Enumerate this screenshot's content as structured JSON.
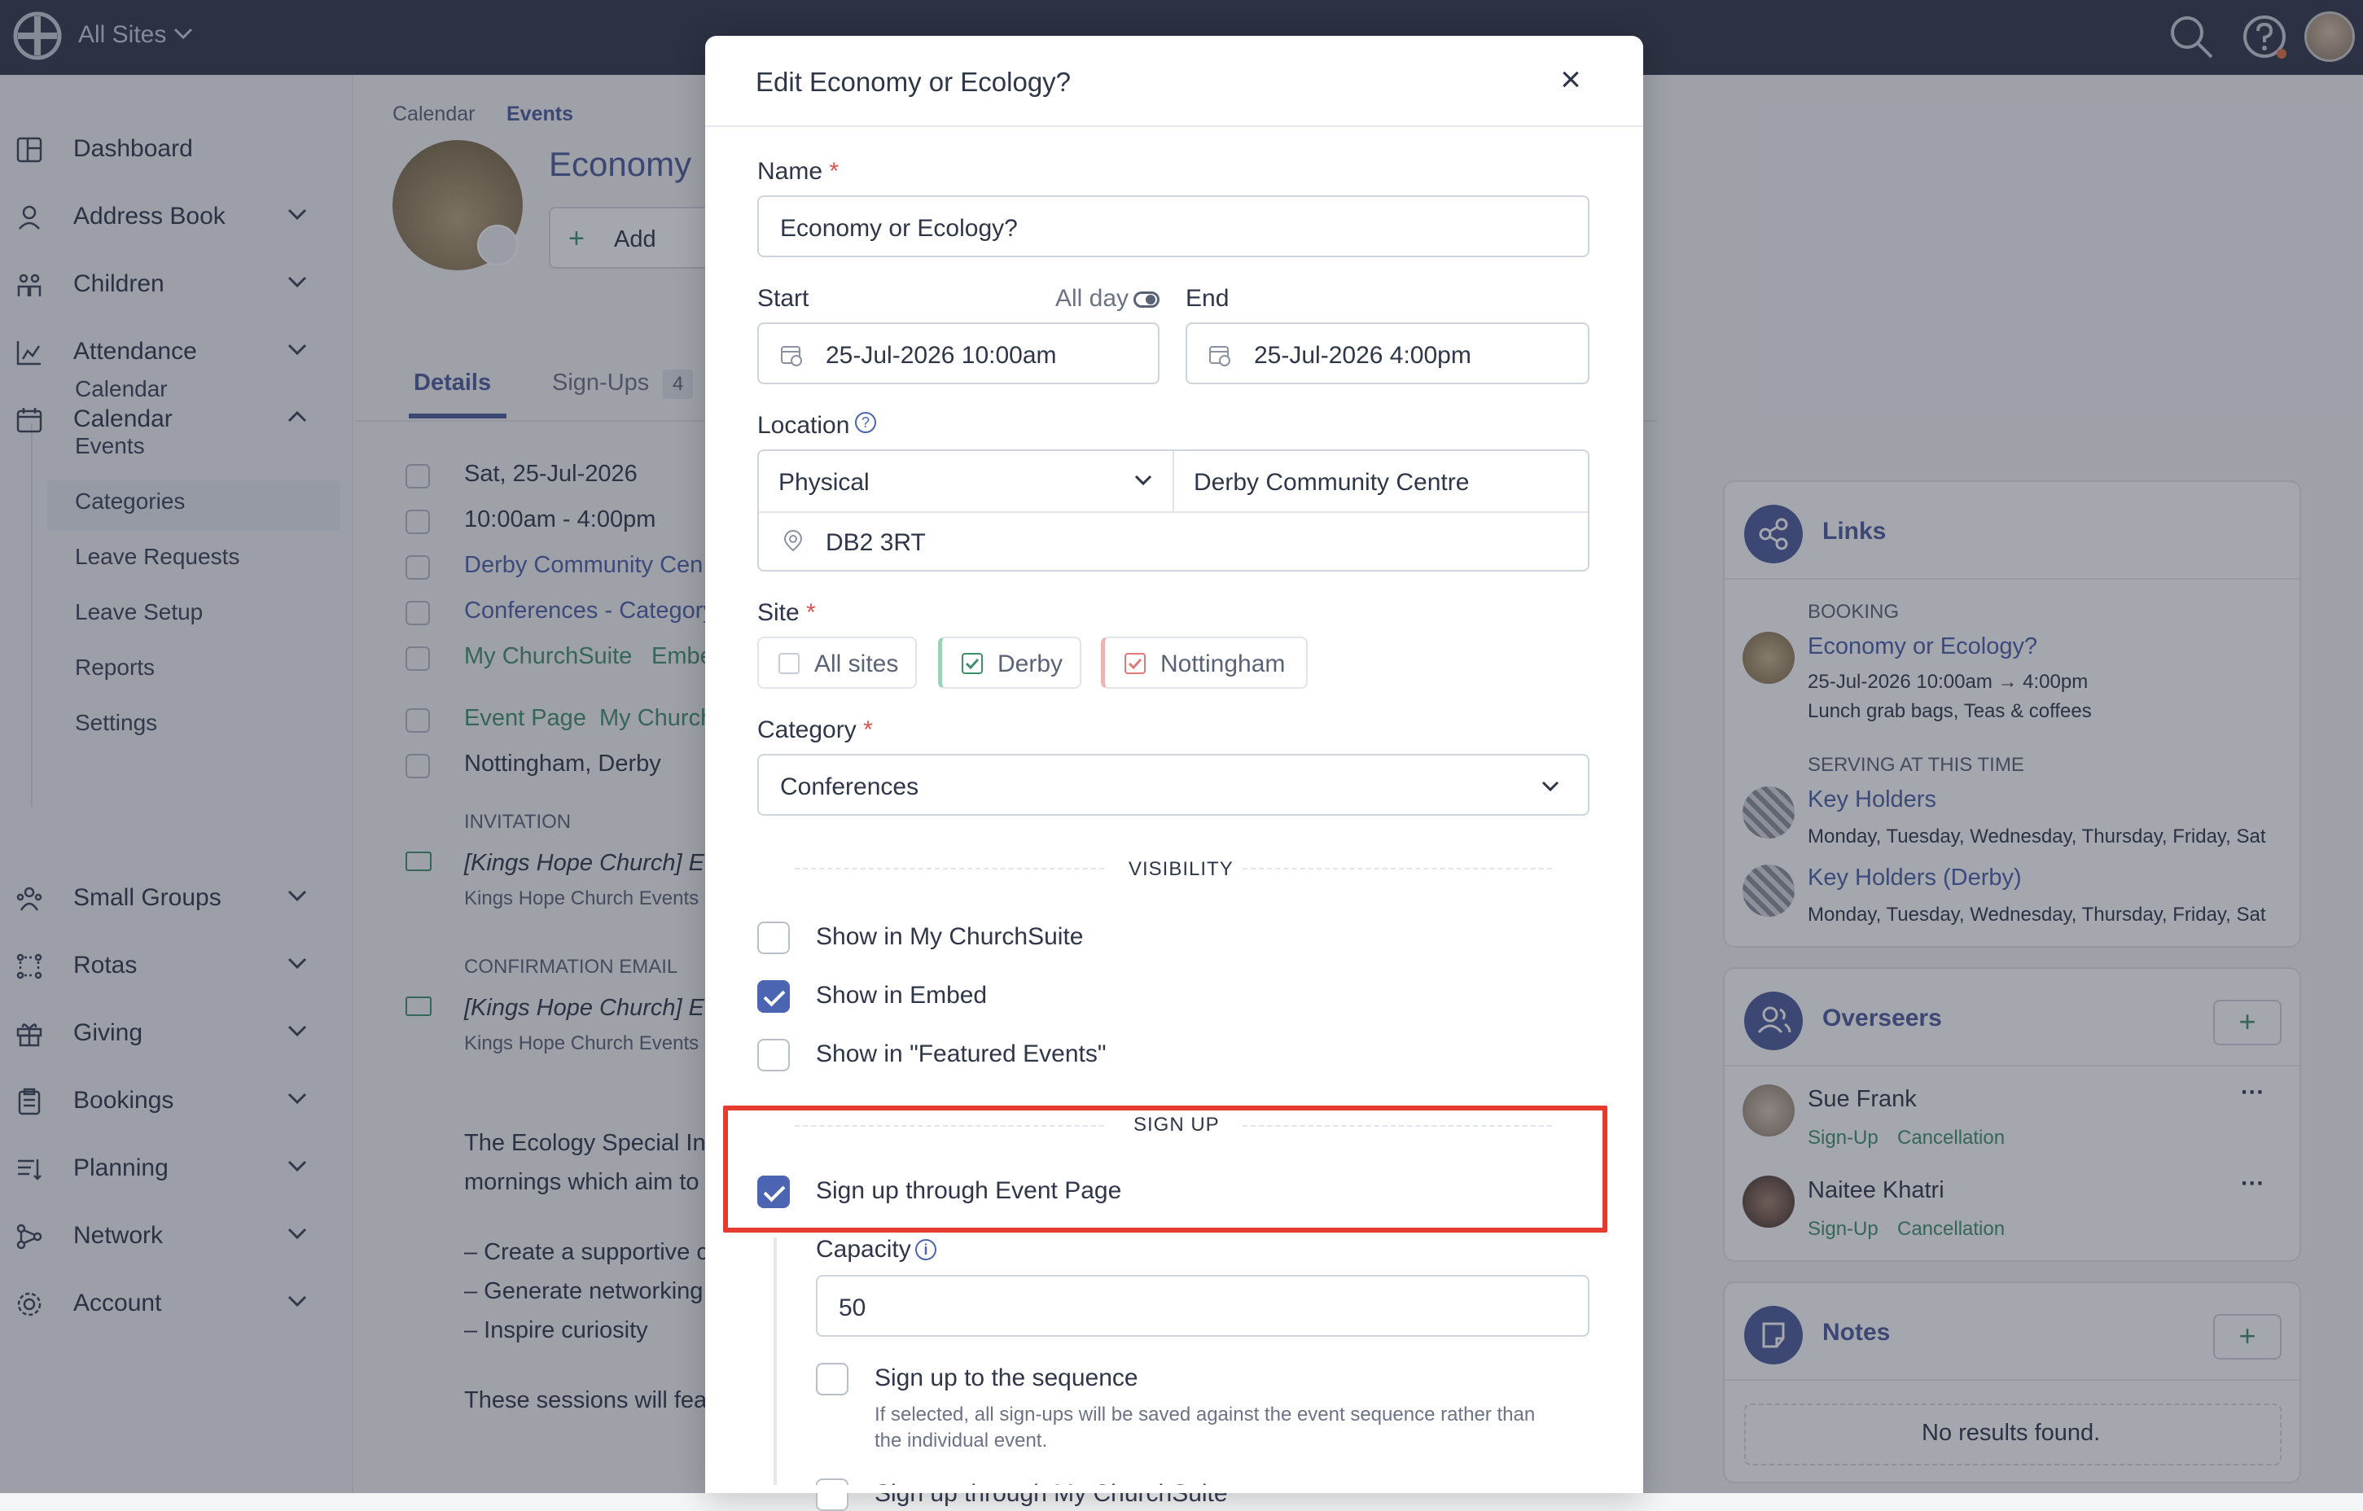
{
  "topbar": {
    "sites_label": "All Sites"
  },
  "sidebar": {
    "items": [
      {
        "label": "Dashboard",
        "icon": "dashboard-icon"
      },
      {
        "label": "Address Book",
        "icon": "person-icon"
      },
      {
        "label": "Children",
        "icon": "children-icon"
      },
      {
        "label": "Attendance",
        "icon": "chart-icon"
      },
      {
        "label": "Calendar",
        "icon": "calendar-icon"
      },
      {
        "label": "Small Groups",
        "icon": "groups-icon"
      },
      {
        "label": "Rotas",
        "icon": "rotas-icon"
      },
      {
        "label": "Giving",
        "icon": "gift-icon"
      },
      {
        "label": "Bookings",
        "icon": "clipboard-icon"
      },
      {
        "label": "Planning",
        "icon": "planning-icon"
      },
      {
        "label": "Network",
        "icon": "network-icon"
      },
      {
        "label": "Account",
        "icon": "gear-icon"
      }
    ],
    "calendar_sub": [
      "Calendar",
      "Events",
      "Categories",
      "Leave Requests",
      "Leave Setup",
      "Reports",
      "Settings"
    ]
  },
  "page": {
    "breadcrumb": [
      "Calendar",
      "Events"
    ],
    "title": "Economy or Ecology?",
    "title_visible": "Economy",
    "add_label": "Add",
    "tabs": [
      {
        "label": "Details"
      },
      {
        "label": "Sign-Ups",
        "count": "4"
      }
    ],
    "details": [
      "Sat, 25-Jul-2026",
      "10:00am - 4:00pm",
      "Derby Community Cen",
      "Conferences - Category",
      "My ChurchSuite",
      "Embe",
      "Event Page",
      "My Church",
      "Nottingham, Derby"
    ],
    "invitation_heading": "INVITATION",
    "invitation_subject": "[Kings Hope Church] Eco",
    "invitation_from": "Kings Hope Church Events",
    "confirmation_heading": "CONFIRMATION EMAIL",
    "confirmation_subject": "[Kings Hope Church] Eco",
    "confirmation_from": "Kings Hope Church Events",
    "description": [
      "The Ecology Special Int",
      "mornings which aim to",
      "– Create a supportive c",
      "– Generate networking",
      "– Inspire curiosity",
      "These sessions will fea"
    ]
  },
  "links": {
    "title": "Links",
    "booking_heading": "BOOKING",
    "booking_title": "Economy or Ecology?",
    "booking_time": "25-Jul-2026 10:00am → 4:00pm",
    "booking_desc": "Lunch grab bags, Teas & coffees",
    "serving_heading": "SERVING AT THIS TIME",
    "serving": [
      {
        "title": "Key Holders",
        "days": "Monday, Tuesday, Wednesday, Thursday, Friday, Sat"
      },
      {
        "title": "Key Holders (Derby)",
        "days": "Monday, Tuesday, Wednesday, Thursday, Friday, Sat"
      }
    ]
  },
  "overseers": {
    "title": "Overseers",
    "people": [
      {
        "name": "Sue Frank",
        "a": "Sign-Up",
        "b": "Cancellation"
      },
      {
        "name": "Naitee Khatri",
        "a": "Sign-Up",
        "b": "Cancellation"
      }
    ]
  },
  "notes": {
    "title": "Notes",
    "empty": "No results found."
  },
  "modal": {
    "title": "Edit Economy or Ecology?",
    "name_label": "Name",
    "name_value": "Economy or Ecology?",
    "start_label": "Start",
    "allday_label": "All day",
    "end_label": "End",
    "start_value": "25-Jul-2026 10:00am",
    "end_value": "25-Jul-2026 4:00pm",
    "location_label": "Location",
    "location_type": "Physical",
    "location_name": "Derby Community Centre",
    "postcode": "DB2 3RT",
    "site_label": "Site",
    "sites": [
      {
        "label": "All sites",
        "checked": false
      },
      {
        "label": "Derby",
        "checked": true,
        "color": "#3f8f6b"
      },
      {
        "label": "Nottingham",
        "checked": true,
        "color": "#e07a7a"
      }
    ],
    "category_label": "Category",
    "category_value": "Conferences",
    "visibility_heading": "VISIBILITY",
    "visibility": [
      {
        "label": "Show in My ChurchSuite",
        "checked": false
      },
      {
        "label": "Show in Embed",
        "checked": true
      },
      {
        "label": "Show in \"Featured Events\"",
        "checked": false
      }
    ],
    "signup_heading": "SIGN UP",
    "signup_through_label": "Sign up through Event Page",
    "signup_through_checked": true,
    "capacity_label": "Capacity",
    "capacity_value": "50",
    "sequence_label": "Sign up to the sequence",
    "sequence_help_1": "If selected, all sign-ups will be saved against the event sequence rather than",
    "sequence_help_2": "the individual event.",
    "next_label": "Sign up through My ChurchSuite"
  },
  "colors": {
    "topbar": "#2f3447",
    "accent": "#4b65b2",
    "green": "#3f8f6b",
    "highlight": "#e63c2f"
  }
}
